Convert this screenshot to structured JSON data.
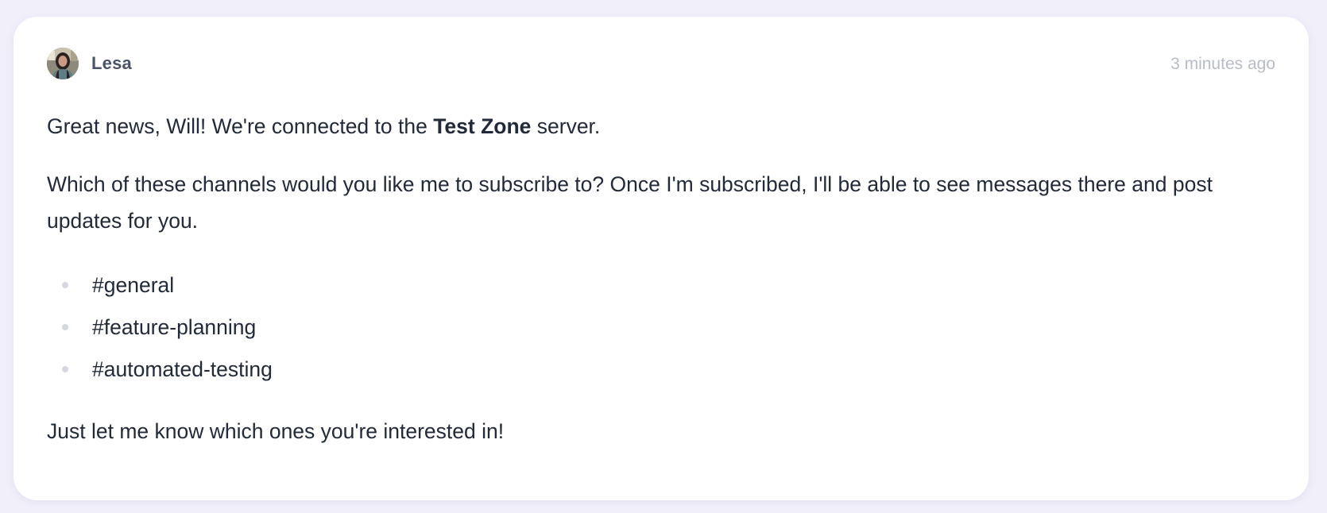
{
  "message": {
    "author": "Lesa",
    "avatar_icon": "user-avatar-photo",
    "timestamp": "3 minutes ago",
    "paragraph1": {
      "before": "Great news, Will! We're connected to the ",
      "bold": "Test Zone",
      "after": " server."
    },
    "paragraph2": "Which of these channels would you like me to subscribe to? Once I'm subscribed, I'll be able to see messages there and post updates for you.",
    "channels": [
      {
        "label": "#general"
      },
      {
        "label": "#feature-planning"
      },
      {
        "label": "#automated-testing"
      }
    ],
    "paragraph3": "Just let me know which ones you're interested in!"
  },
  "colors": {
    "background": "#f1effa",
    "card": "#ffffff",
    "text": "#222a3a",
    "author": "#4a5468",
    "timestamp": "#b7bcc8",
    "bullet": "#d4d7de"
  }
}
